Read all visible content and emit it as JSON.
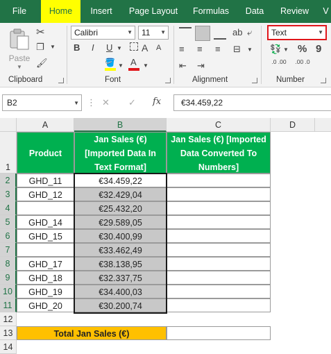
{
  "tabs": [
    "File",
    "Home",
    "Insert",
    "Page Layout",
    "Formulas",
    "Data",
    "Review",
    "V"
  ],
  "ribbon": {
    "clipboard": {
      "paste_label": "Paste",
      "group_label": "Clipboard"
    },
    "font": {
      "name": "Calibri",
      "size": "11",
      "bold": "B",
      "italic": "I",
      "underline": "U",
      "grow": "A",
      "shrink": "A",
      "group_label": "Font"
    },
    "alignment": {
      "group_label": "Alignment"
    },
    "number": {
      "format": "Text",
      "percent": "%",
      "comma": "9",
      "inc": ".0 .00",
      "dec": ".00 .0",
      "group_label": "Number"
    },
    "number_format_highlight": "#e0161b"
  },
  "formula_bar": {
    "name_box": "B2",
    "fx": "fx",
    "cancel": "✕",
    "enter": "✓",
    "value": "€34.459,22"
  },
  "columns": [
    "A",
    "B",
    "C",
    "D"
  ],
  "rows": [
    "1",
    "2",
    "3",
    "4",
    "5",
    "6",
    "7",
    "8",
    "9",
    "10",
    "11",
    "12",
    "13",
    "14"
  ],
  "headers": {
    "a": "Product",
    "b": [
      "Jan Sales (€)",
      "[Imported Data In",
      "Text Format]"
    ],
    "c": [
      "Jan Sales (€) [Imported",
      "Data Converted To",
      "Numbers]"
    ]
  },
  "data": [
    {
      "product": "GHD_11",
      "sales": "€34.459,22"
    },
    {
      "product": "GHD_12",
      "sales": "€32.429,04"
    },
    {
      "product": "",
      "sales": "€25.432,20"
    },
    {
      "product": "GHD_14",
      "sales": "€29.589,05"
    },
    {
      "product": "GHD_15",
      "sales": "€30.400,99"
    },
    {
      "product": "",
      "sales": "€33.462,49"
    },
    {
      "product": "GHD_17",
      "sales": "€38.138,95"
    },
    {
      "product": "GHD_18",
      "sales": "€32.337,75"
    },
    {
      "product": "GHD_19",
      "sales": "€34.400,03"
    },
    {
      "product": "GHD_20",
      "sales": "€30.200,74"
    }
  ],
  "total_label": "Total Jan Sales (€)",
  "colors": {
    "excel_green": "#217346",
    "header_green": "#00b050",
    "total_orange": "#ffc000",
    "selected_gray": "#c8c8c8",
    "yellow": "#ffff00"
  }
}
